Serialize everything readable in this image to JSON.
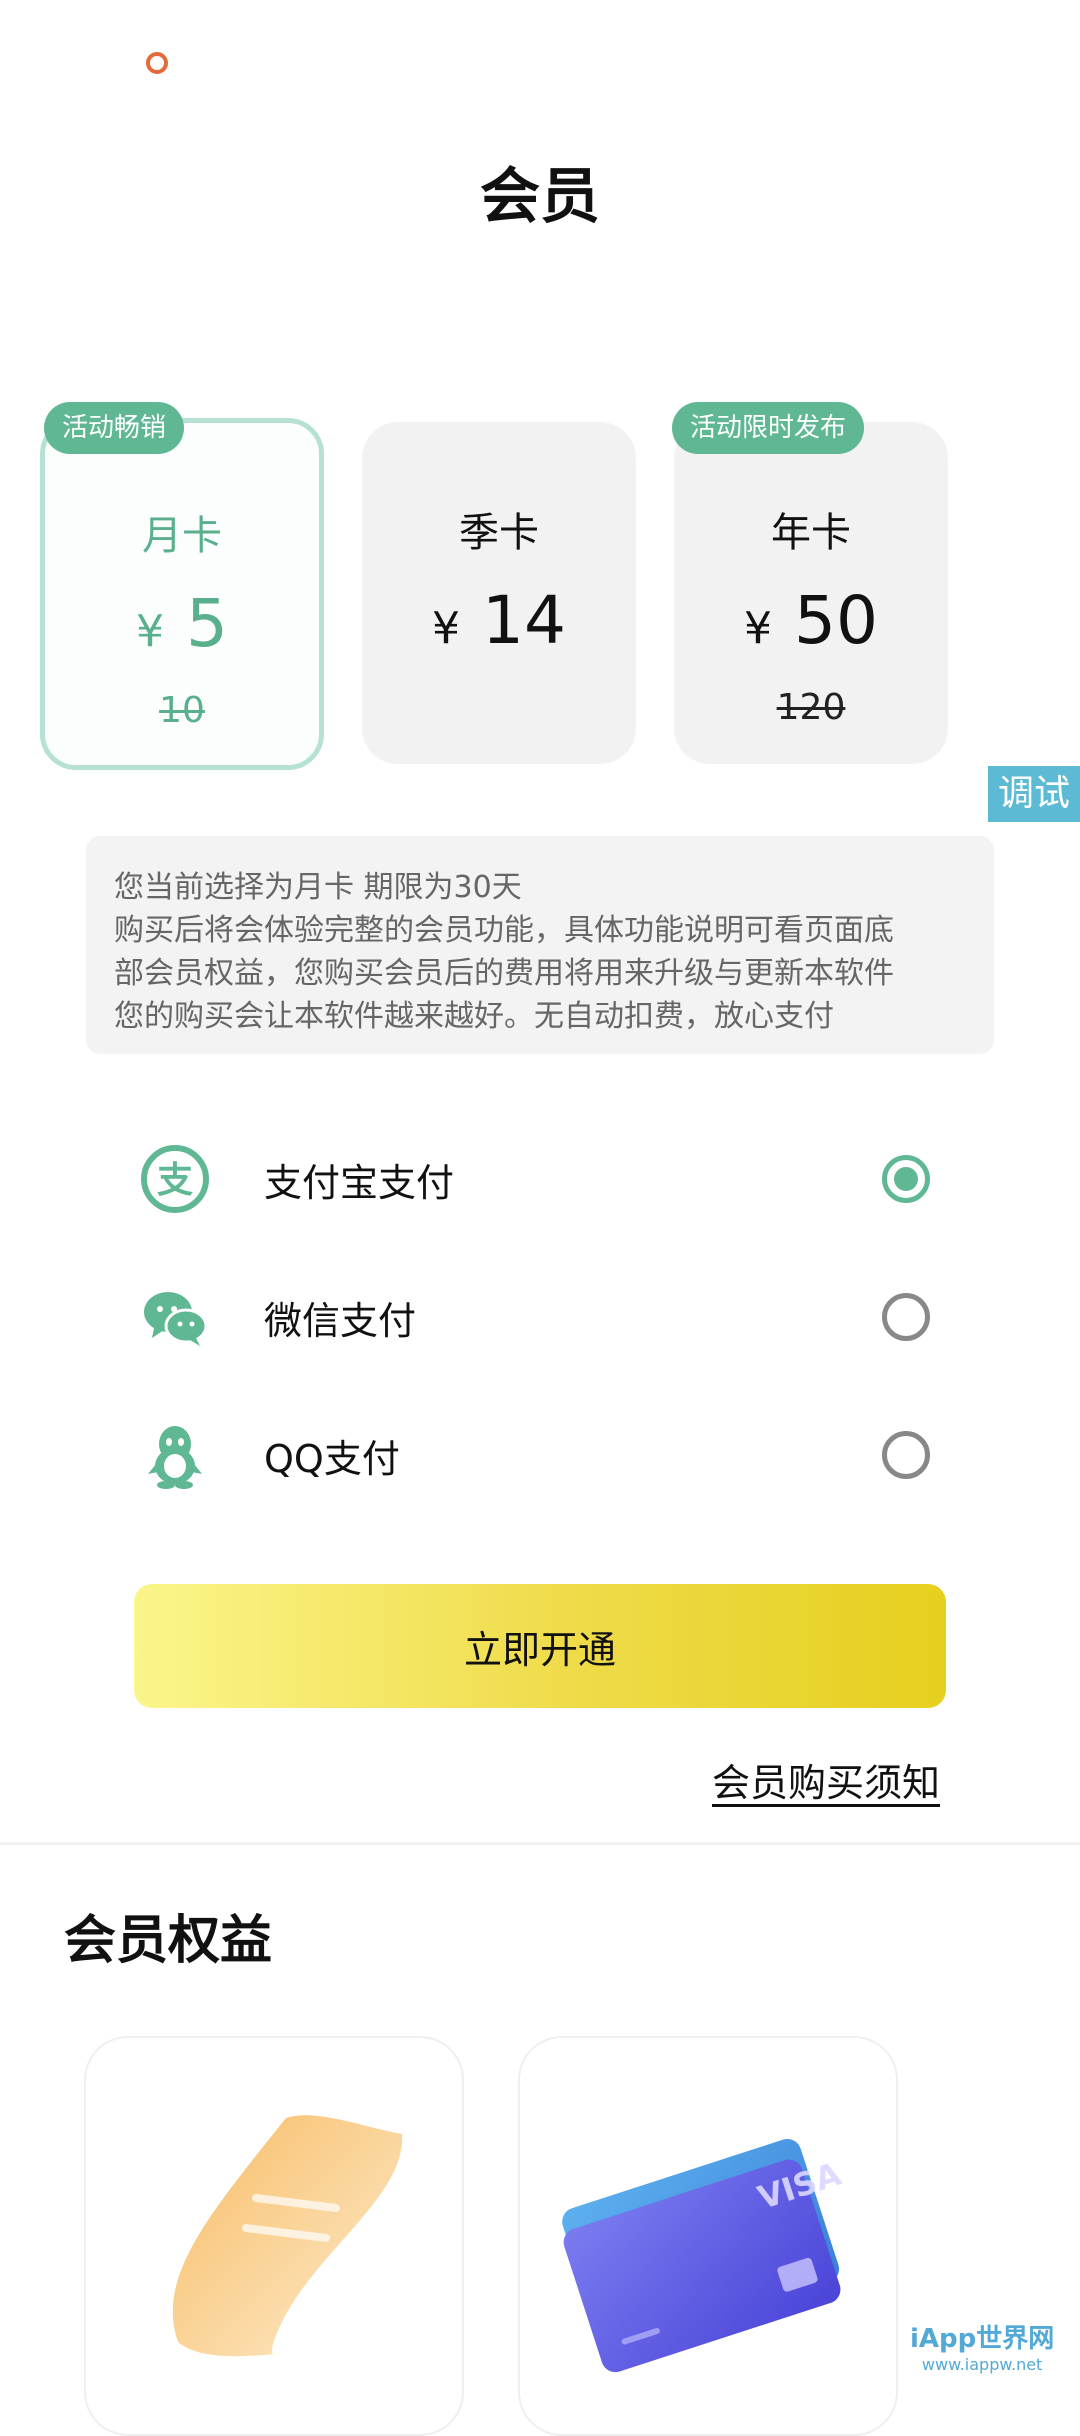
{
  "header": {
    "title": "会员"
  },
  "plans": [
    {
      "name": "月卡",
      "currency": "¥",
      "price": "5",
      "original": "10",
      "tag": "活动畅销",
      "selected": true
    },
    {
      "name": "季卡",
      "currency": "¥",
      "price": "14",
      "original": "",
      "tag": "",
      "selected": false
    },
    {
      "name": "年卡",
      "currency": "¥",
      "price": "50",
      "original": "120",
      "tag": "活动限时发布",
      "selected": false
    }
  ],
  "debug_button": "调试",
  "description": [
    "您当前选择为月卡 期限为30天",
    "购买后将会体验完整的会员功能，具体功能说明可看页面底",
    "部会员权益，您购买会员后的费用将用来升级与更新本软件",
    "您的购买会让本软件越来越好。无自动扣费，放心支付"
  ],
  "payment_methods": [
    {
      "label": "支付宝支付",
      "icon": "alipay-icon",
      "selected": true
    },
    {
      "label": "微信支付",
      "icon": "wechat-icon",
      "selected": false
    },
    {
      "label": "QQ支付",
      "icon": "qq-icon",
      "selected": false
    }
  ],
  "cta": {
    "label": "立即开通"
  },
  "notice_link": "会员购买须知",
  "benefits": {
    "title": "会员权益",
    "cards": [
      {
        "icon": "scroll-icon"
      },
      {
        "icon": "visa-card-icon"
      }
    ]
  },
  "watermark": {
    "line1": "iApp世界网",
    "line2": "www.iappw.net"
  },
  "colors": {
    "accent": "#5fb893",
    "cta_start": "#fbf58a",
    "cta_end": "#e6cf1e",
    "debug": "#5dbad4"
  }
}
